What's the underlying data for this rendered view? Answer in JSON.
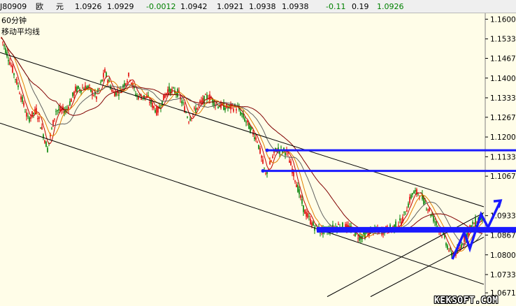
{
  "header": {
    "code": "J80909",
    "currency": "欧",
    "unit": "元",
    "price": "1.0926",
    "ask": "1.0929",
    "change": "-0.0012",
    "high": "1.0942",
    "low": "1.0921",
    "open": "1.0938",
    "prev": "1.0938",
    "pct": "-0.11",
    "amp": "0.19",
    "last": "1.0926"
  },
  "chart": {
    "period_label": "60分钟",
    "indicator_label": "移动平均线"
  },
  "watermark": "KEKSOFT.COM",
  "colors": {
    "background": "#fffde8",
    "candle_up": "#e00000",
    "candle_down": "#008000",
    "ma_short": "#c00000",
    "ma_mid": "#e08000",
    "ma_long": "#606060",
    "ma_xlong": "#800000",
    "trendline": "#000000",
    "annotation": "#1a1aff"
  },
  "chart_data": {
    "type": "candlestick",
    "ylim": [
      1.065,
      1.162
    ],
    "yticks": [
      "1.1600",
      "1.1533",
      "1.1467",
      "1.1400",
      "1.1333",
      "1.1267",
      "1.1200",
      "1.1133",
      "1.1067",
      "1.0933",
      "1.0867",
      "1.0800",
      "1.0733",
      "1.0671"
    ],
    "path": [
      [
        0,
        1.155
      ],
      [
        12,
        1.147
      ],
      [
        25,
        1.138
      ],
      [
        40,
        1.126
      ],
      [
        52,
        1.129
      ],
      [
        68,
        1.116
      ],
      [
        80,
        1.129
      ],
      [
        95,
        1.129
      ],
      [
        108,
        1.136
      ],
      [
        125,
        1.137
      ],
      [
        138,
        1.1335
      ],
      [
        150,
        1.142
      ],
      [
        162,
        1.135
      ],
      [
        172,
        1.1355
      ],
      [
        185,
        1.141
      ],
      [
        195,
        1.134
      ],
      [
        210,
        1.1335
      ],
      [
        225,
        1.1285
      ],
      [
        240,
        1.136
      ],
      [
        255,
        1.135
      ],
      [
        270,
        1.126
      ],
      [
        285,
        1.131
      ],
      [
        298,
        1.134
      ],
      [
        310,
        1.131
      ],
      [
        325,
        1.13
      ],
      [
        340,
        1.13
      ],
      [
        355,
        1.124
      ],
      [
        368,
        1.119
      ],
      [
        380,
        1.107
      ],
      [
        395,
        1.116
      ],
      [
        410,
        1.115
      ],
      [
        422,
        1.106
      ],
      [
        435,
        1.095
      ],
      [
        448,
        1.09
      ],
      [
        458,
        1.088
      ],
      [
        470,
        1.0885
      ],
      [
        485,
        1.09
      ],
      [
        500,
        1.089
      ],
      [
        515,
        1.086
      ],
      [
        530,
        1.088
      ],
      [
        545,
        1.088
      ],
      [
        560,
        1.089
      ],
      [
        575,
        1.0915
      ],
      [
        590,
        1.101
      ],
      [
        600,
        1.101
      ],
      [
        612,
        1.096
      ],
      [
        625,
        1.09
      ],
      [
        635,
        1.086
      ],
      [
        645,
        1.08
      ],
      [
        655,
        1.081
      ],
      [
        665,
        1.086
      ],
      [
        675,
        1.09
      ],
      [
        686,
        1.0925
      ],
      [
        690,
        1.093
      ]
    ],
    "support_lines": [
      {
        "name": "horizontal-line-1",
        "y": 1.1155
      },
      {
        "name": "horizontal-line-2",
        "y": 1.1085
      },
      {
        "name": "horizontal-line-3",
        "y": 1.0885
      }
    ],
    "zigzag": [
      [
        647,
        1.0785
      ],
      [
        664,
        1.0877
      ],
      [
        672,
        1.0821
      ],
      [
        688,
        1.0938
      ],
      [
        698,
        1.0893
      ],
      [
        716,
        1.0984
      ]
    ]
  }
}
